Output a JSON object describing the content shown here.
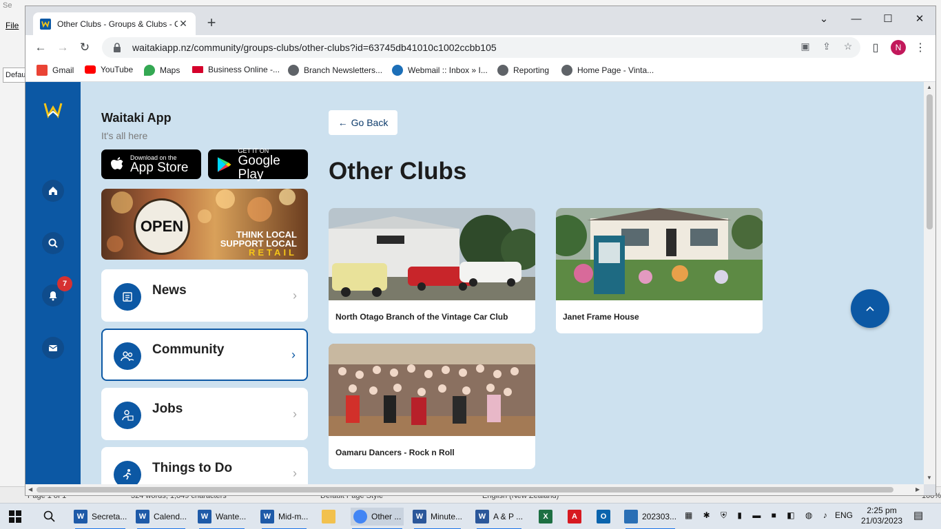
{
  "background_app": {
    "title": "Se",
    "menu_file": "File",
    "style_box": "Defau",
    "status_page": "Page 1 of 1",
    "status_words": "324 words, 1,849 characters",
    "status_style": "Default Page Style",
    "status_lang": "English (New Zealand)",
    "status_zoom": "100%"
  },
  "browser": {
    "tab_title": "Other Clubs - Groups & Clubs - C",
    "url": "waitakiapp.nz/community/groups-clubs/other-clubs?id=63745db41010c1002ccbb105",
    "profile_initial": "N",
    "bookmarks": [
      {
        "label": "Gmail",
        "icon": "gmail-icon",
        "color": "#ea4335"
      },
      {
        "label": "YouTube",
        "icon": "youtube-icon",
        "color": "#ff0000"
      },
      {
        "label": "Maps",
        "icon": "maps-icon",
        "color": "#34a853"
      },
      {
        "label": "Business Online -...",
        "icon": "westpac-icon",
        "color": "#d5002b"
      },
      {
        "label": "Branch Newsletters...",
        "icon": "globe-icon",
        "color": "#5f6368"
      },
      {
        "label": "Webmail :: Inbox » I...",
        "icon": "webmail-icon",
        "color": "#1c6fb8"
      },
      {
        "label": "Reporting",
        "icon": "globe-icon",
        "color": "#5f6368"
      },
      {
        "label": "Home Page - Vinta...",
        "icon": "globe-icon",
        "color": "#5f6368"
      }
    ]
  },
  "app": {
    "brand_title": "Waitaki App",
    "brand_subtitle": "It's all here",
    "appstore_small": "Download on the",
    "appstore_big": "App Store",
    "googleplay_small": "GET IT ON",
    "googleplay_big": "Google Play",
    "promo_open": "OPEN",
    "promo_line1": "THINK LOCAL",
    "promo_line2": "SUPPORT LOCAL",
    "promo_line3": "RETAIL",
    "notification_count": "7",
    "menu": [
      {
        "label": "News",
        "icon": "news-icon",
        "active": false
      },
      {
        "label": "Community",
        "icon": "community-icon",
        "active": true
      },
      {
        "label": "Jobs",
        "icon": "jobs-icon",
        "active": false
      },
      {
        "label": "Things to Do",
        "icon": "things-to-do-icon",
        "active": false
      }
    ],
    "go_back": "Go Back",
    "heading": "Other Clubs",
    "clubs": [
      {
        "name": "North Otago Branch of the Vintage Car Club"
      },
      {
        "name": "Janet Frame House"
      },
      {
        "name": "Oamaru Dancers - Rock n Roll"
      }
    ],
    "colors": {
      "primary": "#0c58a4",
      "page_bg": "#cde1ef",
      "badge": "#d63131"
    }
  },
  "taskbar": {
    "items": [
      {
        "label": "Secreta...",
        "icon": "writer-icon",
        "color": "#1e5aa8"
      },
      {
        "label": "Calend...",
        "icon": "writer-icon",
        "color": "#1e5aa8"
      },
      {
        "label": "Wante...",
        "icon": "writer-icon",
        "color": "#1e5aa8"
      },
      {
        "label": "Mid-m...",
        "icon": "writer-icon",
        "color": "#1e5aa8"
      },
      {
        "label": "Other ...",
        "icon": "chrome-icon",
        "color": "#4285f4"
      },
      {
        "label": "Minute...",
        "icon": "word-icon",
        "color": "#2b579a"
      },
      {
        "label": "A & P ...",
        "icon": "word-icon",
        "color": "#2b579a"
      }
    ],
    "lang": "ENG",
    "time": "2:25 pm",
    "date": "21/03/2023",
    "photos_label": "202303..."
  }
}
